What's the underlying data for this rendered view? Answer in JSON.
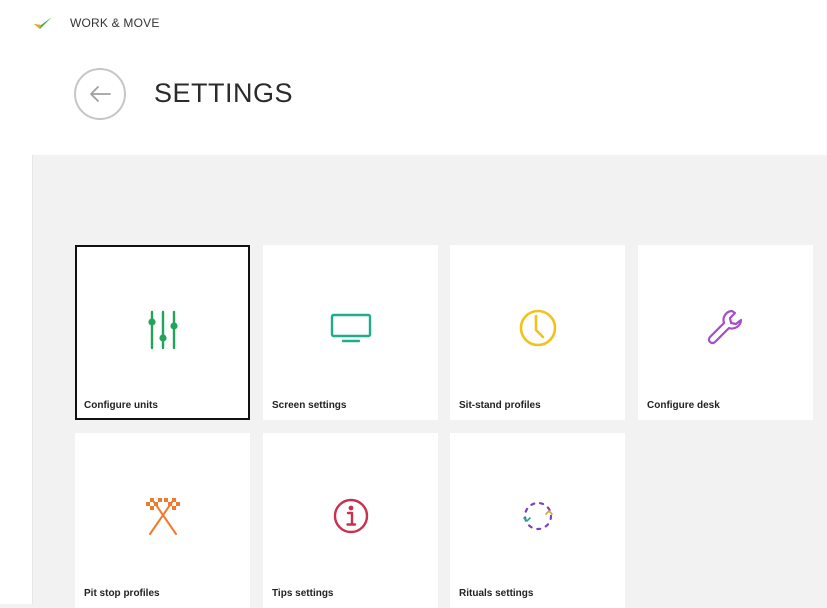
{
  "app": {
    "title": "WORK & MOVE"
  },
  "header": {
    "page_title": "SETTINGS"
  },
  "tiles": [
    {
      "label": "Configure units",
      "icon": "sliders-icon",
      "color": "#22a55a",
      "selected": true
    },
    {
      "label": "Screen settings",
      "icon": "monitor-icon",
      "color": "#1fae8a",
      "selected": false
    },
    {
      "label": "Sit-stand profiles",
      "icon": "clock-icon",
      "color": "#f2c21b",
      "selected": false
    },
    {
      "label": "Configure desk",
      "icon": "wrench-icon",
      "color": "#a64ccf",
      "selected": false
    },
    {
      "label": "Pit stop profiles",
      "icon": "checkered-flags-icon",
      "color": "#f07a2a",
      "selected": false
    },
    {
      "label": "Tips settings",
      "icon": "info-icon",
      "color": "#c8304e",
      "selected": false
    },
    {
      "label": "Rituals settings",
      "icon": "rituals-dashed-circle-icon",
      "color": "#7a3fc8",
      "selected": false
    }
  ]
}
